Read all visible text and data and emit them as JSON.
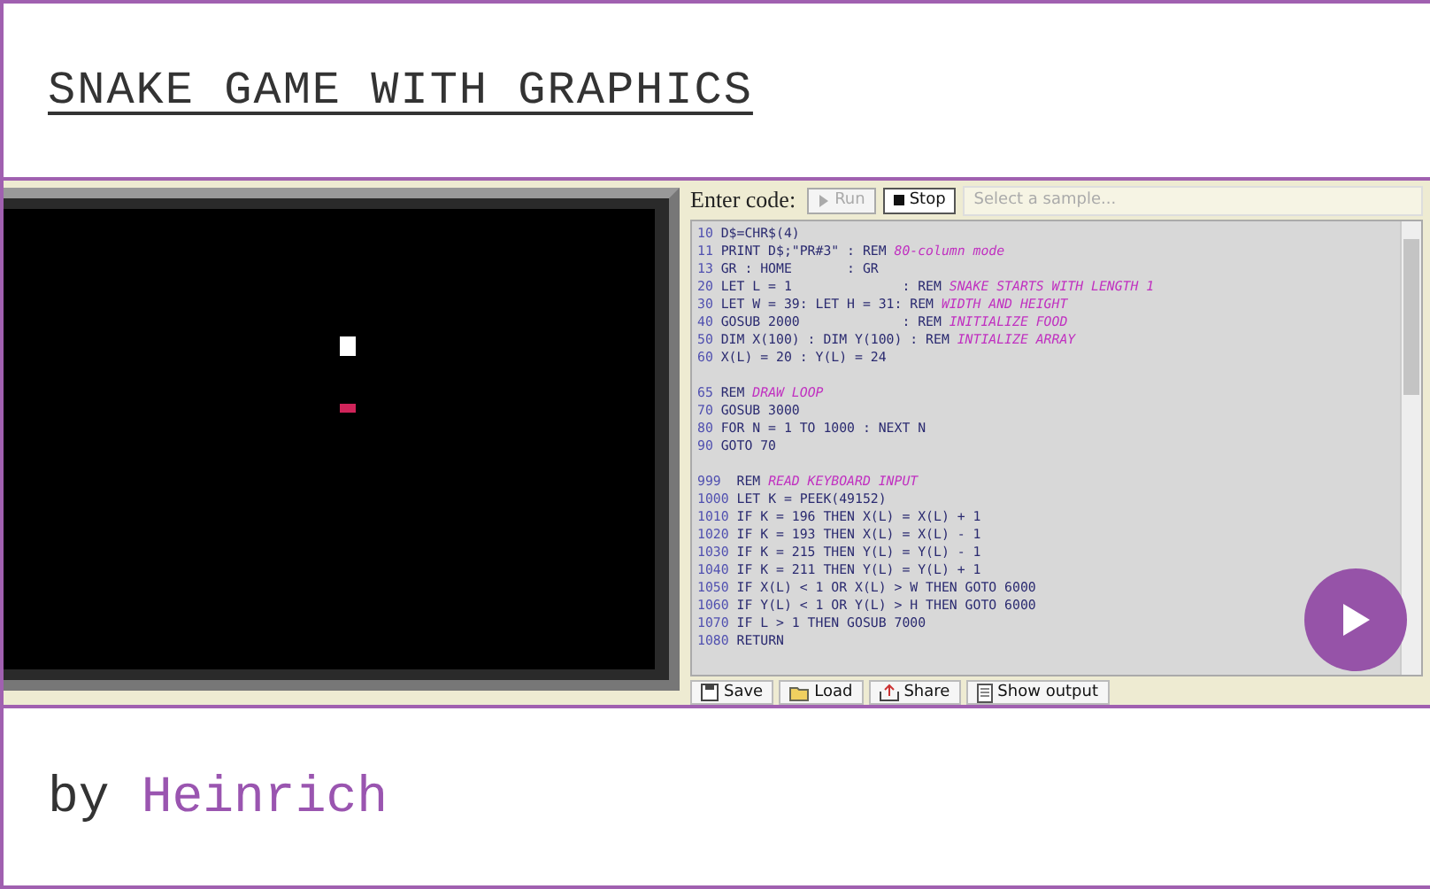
{
  "title": "SNAKE GAME WITH GRAPHICS",
  "emulator": {
    "pixels": [
      {
        "kind": "head",
        "color": "#ffffff"
      },
      {
        "kind": "food",
        "color": "#d0245a"
      }
    ]
  },
  "toolbar": {
    "label": "Enter code:",
    "buttons": [
      {
        "label": "Run",
        "kind": "run",
        "disabled": true
      },
      {
        "label": "Stop",
        "kind": "stop",
        "disabled": false
      }
    ],
    "sample_select": {
      "placeholder": "Select a sample..."
    }
  },
  "code_blocks": [
    [
      {
        "number": "10",
        "code": "D$=CHR$(4)"
      },
      {
        "number": "11",
        "code": "PRINT D$;\"PR#3\" : REM ",
        "comment": "80-column mode"
      },
      {
        "number": "13",
        "code": "GR : HOME       : GR"
      },
      {
        "number": "20",
        "code": "LET L = 1              : REM ",
        "comment": "SNAKE STARTS WITH LENGTH 1"
      },
      {
        "number": "30",
        "code": "LET W = 39: LET H = 31: REM ",
        "comment": "WIDTH AND HEIGHT"
      },
      {
        "number": "40",
        "code": "GOSUB 2000             : REM ",
        "comment": "INITIALIZE FOOD"
      },
      {
        "number": "50",
        "code": "DIM X(100) : DIM Y(100) : REM ",
        "comment": "INTIALIZE ARRAY"
      },
      {
        "number": "60",
        "code": "X(L) = 20 : Y(L) = 24"
      }
    ],
    [
      {
        "number": "65",
        "code": "REM ",
        "comment": "DRAW LOOP"
      },
      {
        "number": "70",
        "code": "GOSUB 3000"
      },
      {
        "number": "80",
        "code": "FOR N = 1 TO 1000 : NEXT N"
      },
      {
        "number": "90",
        "code": "GOTO 70"
      }
    ],
    [
      {
        "number": "999",
        "code": " REM ",
        "comment": "READ KEYBOARD INPUT"
      },
      {
        "number": "1000",
        "code": "LET K = PEEK(49152)"
      },
      {
        "number": "1010",
        "code": "IF K = 196 THEN X(L) = X(L) + 1"
      },
      {
        "number": "1020",
        "code": "IF K = 193 THEN X(L) = X(L) - 1"
      },
      {
        "number": "1030",
        "code": "IF K = 215 THEN Y(L) = Y(L) - 1"
      },
      {
        "number": "1040",
        "code": "IF K = 211 THEN Y(L) = Y(L) + 1"
      },
      {
        "number": "1050",
        "code": "IF X(L) < 1 OR X(L) > W THEN GOTO 6000"
      },
      {
        "number": "1060",
        "code": "IF Y(L) < 1 OR Y(L) > H THEN GOTO 6000"
      },
      {
        "number": "1070",
        "code": "IF L > 1 THEN GOSUB 7000"
      },
      {
        "number": "1080",
        "code": "RETURN"
      }
    ]
  ],
  "bottom_buttons": [
    {
      "label": "Save",
      "kind": "save"
    },
    {
      "label": "Load",
      "kind": "load"
    },
    {
      "label": "Share",
      "kind": "share"
    },
    {
      "label": "Show output",
      "kind": "output"
    }
  ],
  "byline": {
    "prefix": "by",
    "author": "Heinrich"
  }
}
